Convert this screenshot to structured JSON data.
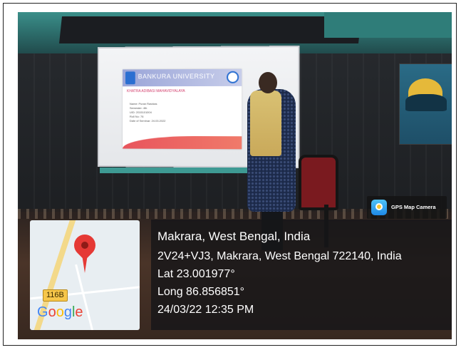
{
  "photo": {
    "slide": {
      "title": "BANKURA UNIVERSITY",
      "subtitle": "KHATRA ADIBASI MAHAVIDYALAYA",
      "rows": [
        "Name: Puran Ravidas",
        "Semester: 4th",
        "UID: 2015101004",
        "Roll No: 76",
        "Date of Seminar: 24.03.2022"
      ]
    }
  },
  "gps_badge": {
    "icon": "map-camera-icon",
    "label": "GPS Map Camera"
  },
  "map": {
    "pin_icon": "location-pin-icon",
    "road_shield": "116B",
    "logo": [
      "G",
      "o",
      "o",
      "g",
      "l",
      "e"
    ],
    "logo_colors": [
      "#4285F4",
      "#EA4335",
      "#FBBC05",
      "#4285F4",
      "#34A853",
      "#EA4335"
    ]
  },
  "location": {
    "place": "Makrara, West Bengal, India",
    "address": "2V24+VJ3, Makrara, West Bengal 722140, India",
    "lat": "Lat 23.001977°",
    "long": "Long 86.856851°",
    "datetime": "24/03/22 12:35 PM"
  }
}
